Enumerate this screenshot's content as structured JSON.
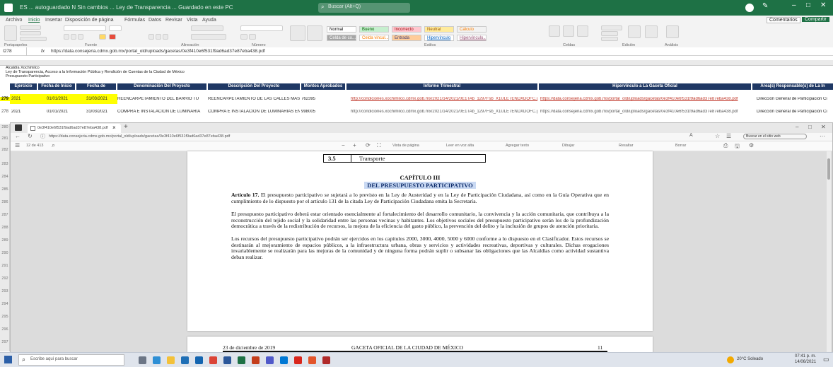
{
  "excel": {
    "app_title": "ES ... autoguardado   N   Sin cambios ... Ley de Transparencia ... Guardado en este PC",
    "search_placeholder": "Buscar (Alt+Q)",
    "share_label": "Compartir",
    "comments_label": "Comentarios",
    "menu_tabs": [
      "Archivo",
      "Inicio",
      "Insertar",
      "Disposición de página",
      "Fórmulas",
      "Datos",
      "Revisar",
      "Vista",
      "Ayuda"
    ],
    "groups": [
      "Portapapeles",
      "Fuente",
      "Alineación",
      "Número",
      "Estilos",
      "Celdas",
      "Edición",
      "Análisis"
    ],
    "styles": [
      {
        "label": "Normal",
        "bg": "#ffffff",
        "fg": "#000000"
      },
      {
        "label": "Bueno",
        "bg": "#c6efce",
        "fg": "#006100"
      },
      {
        "label": "Incorrecto",
        "bg": "#ffc7ce",
        "fg": "#9c0006"
      },
      {
        "label": "Neutral",
        "bg": "#ffeb9c",
        "fg": "#9c5700"
      },
      {
        "label": "Cálculo",
        "bg": "#f2f2f2",
        "fg": "#fa7d00"
      },
      {
        "label": "Celda de co...",
        "bg": "#a5a5a5",
        "fg": "#ffffff"
      },
      {
        "label": "Celda vincul...",
        "bg": "#ffffff",
        "fg": "#fa7d00"
      },
      {
        "label": "Entrada",
        "bg": "#ffcc99",
        "fg": "#3f3f76"
      },
      {
        "label": "Hipervínculo",
        "bg": "#ffffff",
        "fg": "#0563c1"
      },
      {
        "label": "Hipervínculo...",
        "bg": "#ffffff",
        "fg": "#954f72"
      }
    ],
    "name_box": "I278",
    "formula": "https://data.consejeria.cdmx.gob.mx/portal_old/uploads/gacetas/0e3f410e6f531f9ad6ad37e87eba438.pdf",
    "info_lines": [
      "Alcaldía Xochimilco",
      "Ley de Transparencia, Acceso a la Información Pública y Rendición de Cuentas de la Ciudad de México",
      "Presupuesto Participativo"
    ],
    "headers": [
      "Ejercicio",
      "Fecha de Inicio",
      "Fecha de",
      "Denominación Del Proyecto",
      "Descripción Del Proyecto",
      "Montos Aprobados",
      "Informe Trimestral",
      "Hipervínculo a La Gaceta Oficial",
      "Área(s) Responsable(s) de La In"
    ],
    "rows": [
      {
        "num": "279",
        "ejercicio": "2021",
        "inicio": "01/01/2021",
        "fin": "31/03/2021",
        "denominacion": "REENCARPETAMIENTO DEL BARRIO TU",
        "descripcion": "REENCARPETAMIENTO DE LAS CALLES MAS",
        "monto": "762395",
        "informe": "http://condiciones.xochimilco.cdmx.gob.mx/2021/14/2021/0E1TAb_1297Fsb_X1ULE7ENDXDOFC.pdf",
        "gaceta": "https://data.consejeria.cdmx.gob.mx/portal_old/uploads/gacetas/0e3f410e6f531f9ad6ad37e87eba438.pdf",
        "area": "Dirección General de Participación Ci"
      },
      {
        "num": "278",
        "ejercicio": "2021",
        "inicio": "01/01/2021",
        "fin": "31/03/2021",
        "denominacion": "COMPRA E INSTALACIÓN DE LUMINARIA",
        "descripcion": "COMPRA E INSTALACIÓN DE LUMINARIAS EN",
        "monto": "998005",
        "informe": "http://condiciones.xochimilco.cdmx.gob.mx/2021/14/2021/0E1TAb_1297Fsb_X1ULE7ENDXDOFC.pdf",
        "gaceta": "https://data.consejeria.cdmx.gob.mx/portal_old/uploads/gacetas/0e3f410e6f531f9ad6ad37e87eba438.pdf",
        "area": "Dirección General de Participación Ci"
      }
    ],
    "left_row_numbers": [
      "280",
      "281",
      "282",
      "283",
      "284",
      "285",
      "286",
      "287",
      "288",
      "289",
      "290",
      "291",
      "292",
      "293",
      "294",
      "295",
      "296",
      "297"
    ]
  },
  "browser": {
    "tab_title": "0e3f410e6f531f9ad6ad37e87eba438.pdf",
    "url": "https://data.consejeria.cdmx.gob.mx/portal_old/uploads/gacetas/0e3f410e6f531f9ad6ad37e87eba438.pdf",
    "page_counter": "12 de 413",
    "toolbar": [
      "Vista de página",
      "Leer en voz alta",
      "Agregar texto",
      "Dibujar",
      "Resaltar",
      "Borrar"
    ],
    "search_text": "Buscar en el sitio web"
  },
  "pdf": {
    "table_num": "3.5",
    "table_text": "Transporte",
    "chapter": "CAPÍTULO III",
    "chapter_title": "DEL PRESUPUESTO PARTICIPATIVO",
    "article_label": "Artículo 17.",
    "p1": "El presupuesto participativo se sujetará a lo previsto en la Ley de Austeridad y en la Ley de Participación Ciudadana, así como en la Guía Operativa que en cumplimiento de lo dispuesto por el artículo 131 de la citada Ley de Participación Ciudadana emita la Secretaría.",
    "p2": "El presupuesto participativo deberá estar orientado esencialmente al fortalecimiento del desarrollo comunitario, la convivencia y la acción comunitaria, que contribuya a la reconstrucción del tejido social y la solidaridad entre las personas vecinas y habitantes. Los objetivos sociales del presupuesto participativo serán los de la profundización democrática a través de la redistribución de recursos, la mejora de la eficiencia del gasto público, la prevención del delito y la inclusión de grupos de atención prioritaria.",
    "p3": "Los recursos del presupuesto participativo podrán ser ejercidos en los capítulos 2000, 3000, 4000, 5000 y 6000 conforme a lo dispuesto en el Clasificador. Estos recursos se destinarán al mejoramiento de espacios públicos, a la infraestructura urbana, obras y servicios y actividades recreativas, deportivas y culturales. Dichas erogaciones invariablemente se realizarán para las mejoras de la comunidad y de ninguna forma podrán suplir o subsanar las obligaciones que las Alcaldías como actividad sustantiva deban realizar.",
    "footer_date": "23 de diciembre de 2019",
    "footer_title": "GACETA OFICIAL DE LA CIUDAD DE MÉXICO",
    "footer_page": "11"
  },
  "taskbar": {
    "search_placeholder": "Escribe aquí para buscar",
    "weather": "20°C Soleado",
    "time": "07:41 p. m.",
    "date": "14/06/2021"
  }
}
